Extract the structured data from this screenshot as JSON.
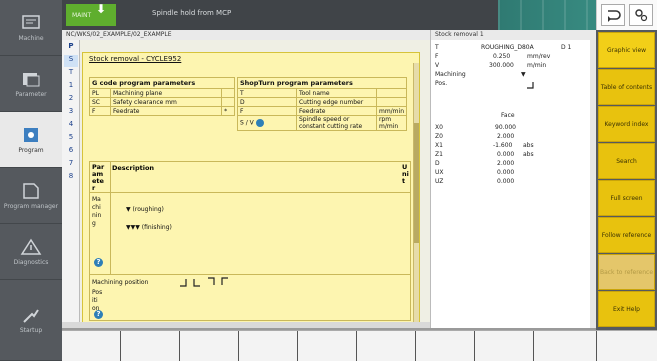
{
  "top_bar": {
    "alarm_label": "MAINT",
    "status_text": "Spindle hold from MCP"
  },
  "left_bar": {
    "items": [
      {
        "label": "Machine",
        "icon": "machine-icon"
      },
      {
        "label": "Parameter",
        "icon": "parameter-icon"
      },
      {
        "label": "Program",
        "icon": "program-icon"
      },
      {
        "label": "Program manager",
        "icon": "program-manager-icon"
      },
      {
        "label": "Diagnostics",
        "icon": "diagnostics-icon"
      },
      {
        "label": "Startup",
        "icon": "startup-icon"
      }
    ]
  },
  "breadcrumb": "NC/WKS/02_EXAMPLE/02_EXAMPLE",
  "context_title": "Stock removal 1",
  "sequence": [
    "P",
    "S",
    "T",
    "1",
    "2",
    "3",
    "4",
    "5",
    "6",
    "7",
    "8"
  ],
  "dialog": {
    "title": "Stock removal - CYCLE952",
    "g_code_header": "G code program parameters",
    "g_code_rows": [
      {
        "param": "PL",
        "desc": "Machining plane",
        "unit": ""
      },
      {
        "param": "SC",
        "desc": "Safety clearance mm",
        "unit": ""
      },
      {
        "param": "F",
        "desc": "Feedrate",
        "unit": "*"
      }
    ],
    "shop_header": "ShopTurn program parameters",
    "shop_rows": [
      {
        "param": "T",
        "desc": "Tool name",
        "unit": ""
      },
      {
        "param": "D",
        "desc": "Cutting edge number",
        "unit": ""
      },
      {
        "param": "F",
        "desc": "Feedrate",
        "unit": "mm/min"
      },
      {
        "param": "S / V",
        "desc": "Spindle speed or constant cutting rate",
        "unit": "rpm m/min"
      }
    ],
    "description": {
      "header_par": "Par am ete r",
      "header_desc": "Description",
      "header_unit": "U ni t",
      "left_col": "Ma chi nin g",
      "opt1": "▼ (roughing)",
      "opt2": "▼▼▼ (finishing)",
      "position_label": "Machining position",
      "left_col2": "Pos iti on"
    }
  },
  "right_panel": {
    "rows": [
      {
        "k": "T",
        "v": "ROUGHING_D80A",
        "extra": "D 1"
      },
      {
        "k": "F",
        "v": "0.250",
        "extra": "mm/rev"
      },
      {
        "k": "V",
        "v": "300.000",
        "extra": "m/min"
      },
      {
        "k": "Machining",
        "v": "",
        "extra": ""
      },
      {
        "k": "Pos.",
        "v": "",
        "extra": ""
      },
      {
        "k": "",
        "v": "Face",
        "extra": ""
      },
      {
        "k": "X0",
        "v": "90.000",
        "extra": ""
      },
      {
        "k": "Z0",
        "v": "2.000",
        "extra": ""
      },
      {
        "k": "X1",
        "v": "-1.600",
        "extra": "abs"
      },
      {
        "k": "Z1",
        "v": "0.000",
        "extra": "abs"
      },
      {
        "k": "D",
        "v": "2.000",
        "extra": ""
      },
      {
        "k": "UX",
        "v": "0.000",
        "extra": ""
      },
      {
        "k": "UZ",
        "v": "0.000",
        "extra": ""
      }
    ]
  },
  "vertical_softkeys": [
    {
      "label": "Graphic view",
      "state": "on"
    },
    {
      "label": "Table of contents",
      "state": "normal"
    },
    {
      "label": "Keyword index",
      "state": "normal"
    },
    {
      "label": "Search",
      "state": "normal"
    },
    {
      "label": "Full screen",
      "state": "normal"
    },
    {
      "label": "Follow reference",
      "state": "normal"
    },
    {
      "label": "Back to reference",
      "state": "disabled"
    },
    {
      "label": "Exit Help",
      "state": "normal"
    }
  ]
}
